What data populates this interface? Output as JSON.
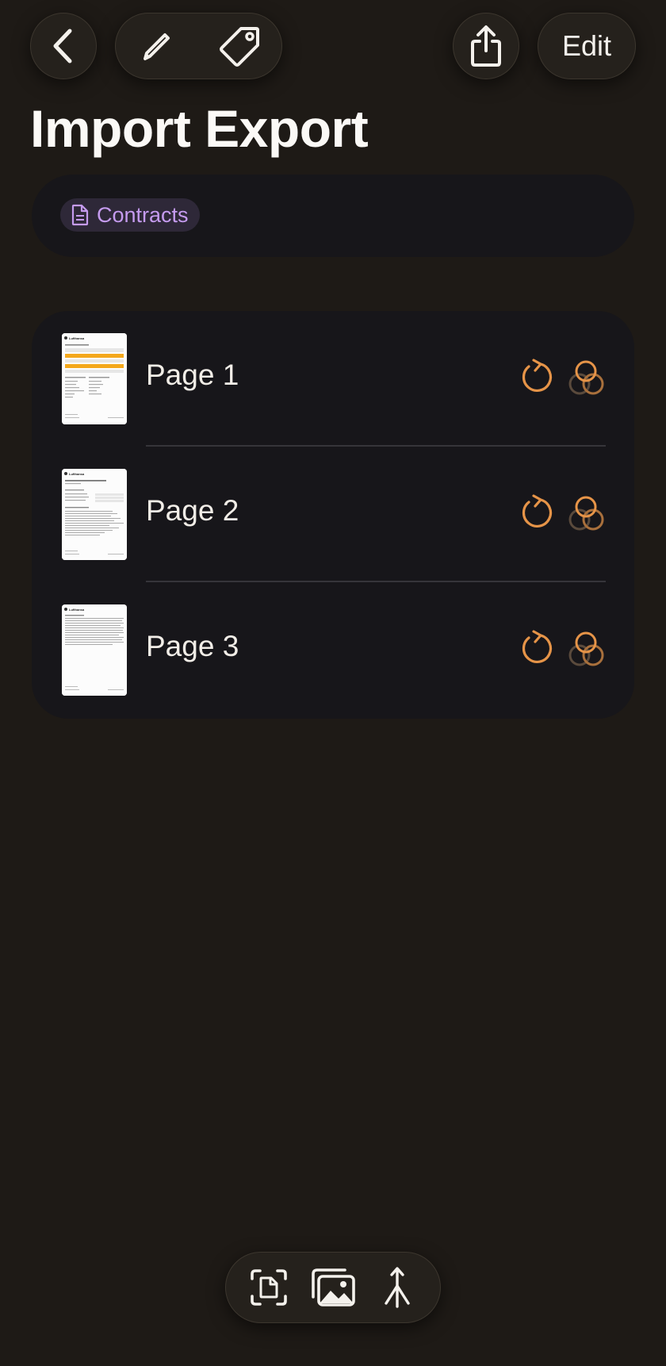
{
  "header": {
    "title": "Import Export",
    "edit_label": "Edit",
    "icons": [
      "chevron-left-icon",
      "pencil-icon",
      "tag-icon",
      "share-icon"
    ]
  },
  "tags": [
    {
      "label": "Contracts",
      "icon": "document-icon",
      "color": "#c59bef"
    }
  ],
  "pages": [
    {
      "label": "Page 1"
    },
    {
      "label": "Page 2"
    },
    {
      "label": "Page 3"
    }
  ],
  "thumbnail_header_text": "Lufthansa",
  "colors": {
    "accent": "#e69448",
    "tag": "#c59bef",
    "background": "#1e1a16",
    "card": "#17161a"
  },
  "bottom_toolbar": {
    "icons": [
      "scan-document-icon",
      "photo-library-icon",
      "merge-icon"
    ]
  }
}
